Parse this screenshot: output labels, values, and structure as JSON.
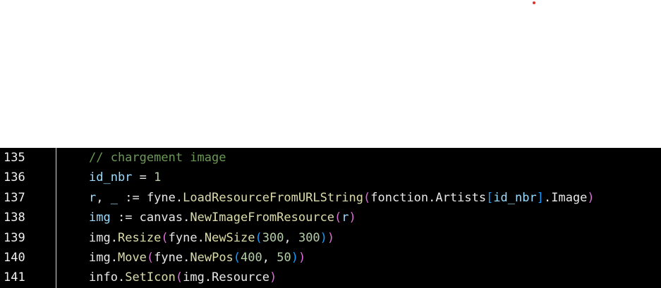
{
  "editor": {
    "lines": [
      {
        "number": "135",
        "tokens": [
          {
            "text": "// chargement image",
            "kind": "comment"
          }
        ]
      },
      {
        "number": "136",
        "tokens": [
          {
            "text": "id_nbr",
            "kind": "var"
          },
          {
            "text": " = ",
            "kind": "plain"
          },
          {
            "text": "1",
            "kind": "num"
          }
        ]
      },
      {
        "number": "137",
        "tokens": [
          {
            "text": "r",
            "kind": "var"
          },
          {
            "text": ", ",
            "kind": "plain"
          },
          {
            "text": "_",
            "kind": "var"
          },
          {
            "text": " := ",
            "kind": "plain"
          },
          {
            "text": "fyne",
            "kind": "plain"
          },
          {
            "text": ".",
            "kind": "plain"
          },
          {
            "text": "LoadResourceFromURLString",
            "kind": "fn"
          },
          {
            "text": "(",
            "kind": "b2"
          },
          {
            "text": "fonction",
            "kind": "plain"
          },
          {
            "text": ".",
            "kind": "plain"
          },
          {
            "text": "Artists",
            "kind": "plain"
          },
          {
            "text": "[",
            "kind": "b3"
          },
          {
            "text": "id_nbr",
            "kind": "var"
          },
          {
            "text": "]",
            "kind": "b3"
          },
          {
            "text": ".",
            "kind": "plain"
          },
          {
            "text": "Image",
            "kind": "plain"
          },
          {
            "text": ")",
            "kind": "b2"
          }
        ]
      },
      {
        "number": "138",
        "tokens": [
          {
            "text": "img",
            "kind": "var"
          },
          {
            "text": " := ",
            "kind": "plain"
          },
          {
            "text": "canvas",
            "kind": "plain"
          },
          {
            "text": ".",
            "kind": "plain"
          },
          {
            "text": "NewImageFromResource",
            "kind": "fn"
          },
          {
            "text": "(",
            "kind": "b2"
          },
          {
            "text": "r",
            "kind": "var"
          },
          {
            "text": ")",
            "kind": "b2"
          }
        ]
      },
      {
        "number": "139",
        "tokens": [
          {
            "text": "img",
            "kind": "plain"
          },
          {
            "text": ".",
            "kind": "plain"
          },
          {
            "text": "Resize",
            "kind": "fn"
          },
          {
            "text": "(",
            "kind": "b2"
          },
          {
            "text": "fyne",
            "kind": "plain"
          },
          {
            "text": ".",
            "kind": "plain"
          },
          {
            "text": "NewSize",
            "kind": "fn"
          },
          {
            "text": "(",
            "kind": "b3"
          },
          {
            "text": "300",
            "kind": "num"
          },
          {
            "text": ", ",
            "kind": "plain"
          },
          {
            "text": "300",
            "kind": "num"
          },
          {
            "text": ")",
            "kind": "b3"
          },
          {
            "text": ")",
            "kind": "b2"
          }
        ]
      },
      {
        "number": "140",
        "tokens": [
          {
            "text": "img",
            "kind": "plain"
          },
          {
            "text": ".",
            "kind": "plain"
          },
          {
            "text": "Move",
            "kind": "fn"
          },
          {
            "text": "(",
            "kind": "b2"
          },
          {
            "text": "fyne",
            "kind": "plain"
          },
          {
            "text": ".",
            "kind": "plain"
          },
          {
            "text": "NewPos",
            "kind": "fn"
          },
          {
            "text": "(",
            "kind": "b3"
          },
          {
            "text": "400",
            "kind": "num"
          },
          {
            "text": ", ",
            "kind": "plain"
          },
          {
            "text": "50",
            "kind": "num"
          },
          {
            "text": ")",
            "kind": "b3"
          },
          {
            "text": ")",
            "kind": "b2"
          }
        ]
      },
      {
        "number": "141",
        "tokens": [
          {
            "text": "info",
            "kind": "plain"
          },
          {
            "text": ".",
            "kind": "plain"
          },
          {
            "text": "SetIcon",
            "kind": "fn"
          },
          {
            "text": "(",
            "kind": "b2"
          },
          {
            "text": "img",
            "kind": "plain"
          },
          {
            "text": ".",
            "kind": "plain"
          },
          {
            "text": "Resource",
            "kind": "plain"
          },
          {
            "text": ")",
            "kind": "b2"
          }
        ]
      }
    ]
  },
  "colors": {
    "background": "#000000",
    "comment": "#6a9955",
    "variable": "#9cdcfe",
    "function": "#dcdcaa",
    "number": "#b5cea8",
    "bracket_level_2": "#da70d6",
    "bracket_level_3": "#179fff",
    "marker_dot": "#e0302a"
  }
}
